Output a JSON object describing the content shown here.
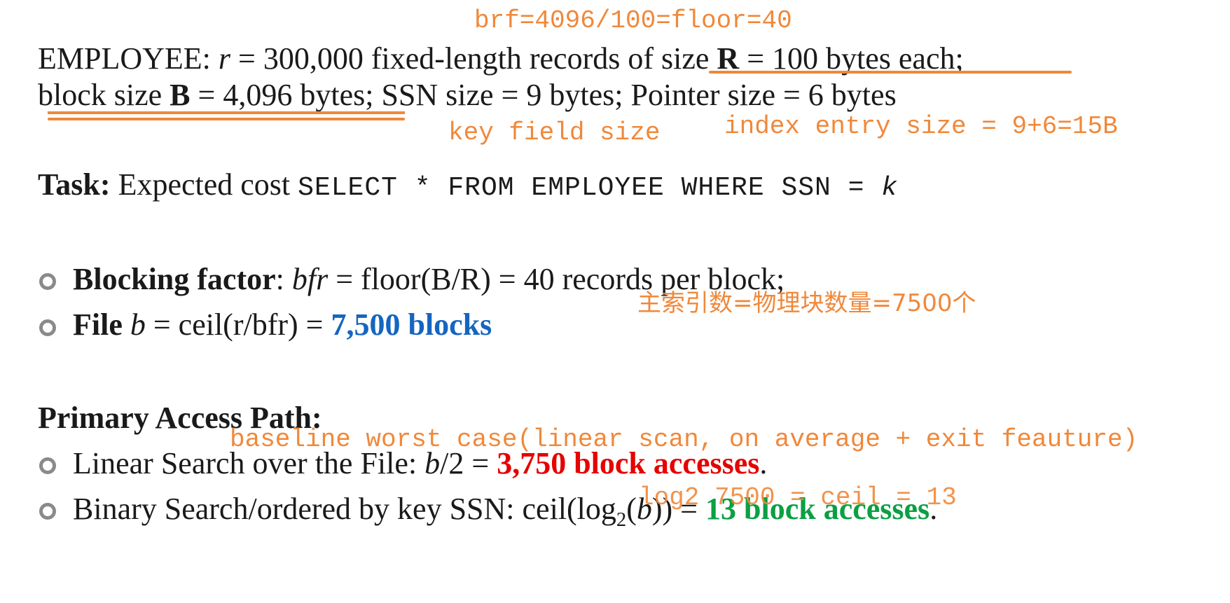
{
  "colors": {
    "annotation": "#f0883a",
    "blue": "#1565c0",
    "red": "#e60000",
    "green": "#0aa044",
    "text": "#1a1a1a",
    "bullet": "#8a8a8a"
  },
  "annotations": {
    "brf": "brf=4096/100=floor=40",
    "key_field": "key field size",
    "index_entry": "index entry size = 9+6=15B",
    "primary_index": "主索引数=物理块数量=7500个",
    "baseline": "baseline worst case(linear scan, on average + exit feauture)",
    "log2": "log2 7500 = ceil = 13"
  },
  "line1": {
    "p1": "EMPLOYEE: ",
    "r": "r",
    "p2": " = 300,000 fixed-length records of size ",
    "R": "R",
    "p3": " = 100 bytes each;"
  },
  "line2": {
    "p1": "block size ",
    "B": "B",
    "p2": " = 4,096 bytes; SSN size = 9 bytes; Pointer size = 6 bytes"
  },
  "task": {
    "label": "Task:",
    "text": " Expected cost ",
    "query": "SELECT * FROM EMPLOYEE WHERE SSN = ",
    "k": "k"
  },
  "blocking": {
    "label": "Blocking factor",
    "colon": ": ",
    "bfr": "bfr",
    "rest": " = floor(B/R) = 40 records per block;"
  },
  "file": {
    "label": "File",
    "b": "b",
    "rest": " = ceil(r/bfr) = ",
    "result": "7,500 blocks"
  },
  "primary": {
    "heading": "Primary Access Path:",
    "linear_text": "Linear Search over the File: ",
    "linear_b": "b",
    "linear_div": "/2 = ",
    "linear_result": "3,750 block accesses",
    "binary_text": "Binary Search/ordered by key SSN: ceil(log",
    "binary_sub": "2",
    "binary_paren": "(",
    "binary_b": "b",
    "binary_close": ")) = ",
    "binary_result": "13 block accesses",
    "period": "."
  }
}
